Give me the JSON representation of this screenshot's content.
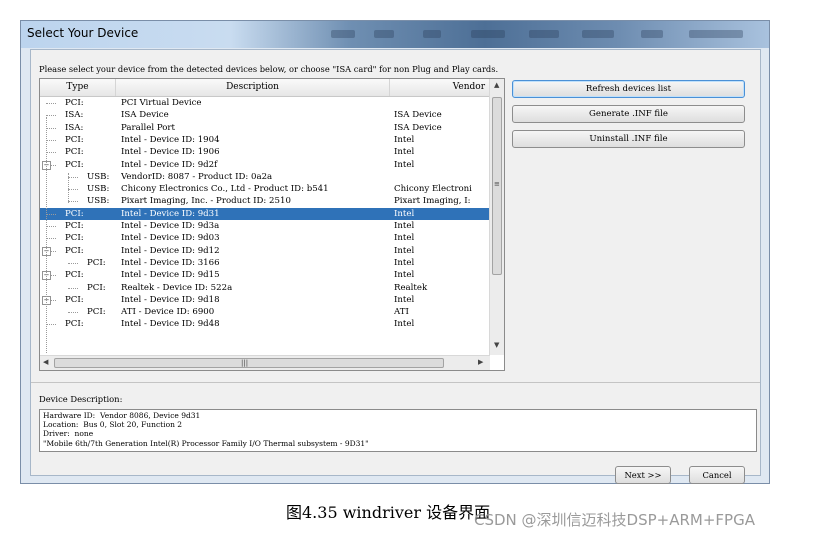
{
  "window": {
    "title": "Select Your Device"
  },
  "prompt": "Please select your device from the detected devices below, or choose \"ISA card\" for non Plug and Play cards.",
  "table": {
    "columns": [
      "Type",
      "Description",
      "Vendor"
    ],
    "rows": [
      {
        "type": "PCI:",
        "desc": "PCI Virtual Device",
        "vendor": ""
      },
      {
        "type": "ISA:",
        "desc": "ISA Device",
        "vendor": "ISA Device"
      },
      {
        "type": "ISA:",
        "desc": "Parallel Port",
        "vendor": "ISA Device"
      },
      {
        "type": "PCI:",
        "desc": "Intel - Device ID: 1904",
        "vendor": "Intel"
      },
      {
        "type": "PCI:",
        "desc": "Intel - Device ID: 1906",
        "vendor": "Intel"
      },
      {
        "type": "PCI:",
        "desc": "Intel - Device ID: 9d2f",
        "vendor": "Intel"
      },
      {
        "type": "USB:",
        "desc": "VendorID: 8087 - Product ID: 0a2a",
        "vendor": ""
      },
      {
        "type": "USB:",
        "desc": "Chicony Electronics Co., Ltd - Product ID: b541",
        "vendor": "Chicony Electroni"
      },
      {
        "type": "USB:",
        "desc": "Pixart Imaging, Inc. - Product ID: 2510",
        "vendor": "Pixart Imaging, I:"
      },
      {
        "type": "PCI:",
        "desc": "Intel - Device ID: 9d31",
        "vendor": "Intel"
      },
      {
        "type": "PCI:",
        "desc": "Intel - Device ID: 9d3a",
        "vendor": "Intel"
      },
      {
        "type": "PCI:",
        "desc": "Intel - Device ID: 9d03",
        "vendor": "Intel"
      },
      {
        "type": "PCI:",
        "desc": "Intel - Device ID: 9d12",
        "vendor": "Intel"
      },
      {
        "type": "PCI:",
        "desc": "Intel - Device ID: 3166",
        "vendor": "Intel"
      },
      {
        "type": "PCI:",
        "desc": "Intel - Device ID: 9d15",
        "vendor": "Intel"
      },
      {
        "type": "PCI:",
        "desc": "Realtek - Device ID: 522a",
        "vendor": "Realtek"
      },
      {
        "type": "PCI:",
        "desc": "Intel - Device ID: 9d18",
        "vendor": "Intel"
      },
      {
        "type": "PCI:",
        "desc": "ATI - Device ID: 6900",
        "vendor": "ATI"
      },
      {
        "type": "PCI:",
        "desc": "Intel - Device ID: 9d48",
        "vendor": "Intel"
      }
    ],
    "selected_row": 9,
    "hscroll_grip": "|||"
  },
  "buttons": {
    "refresh": "Refresh devices list",
    "generate_inf": "Generate .INF file",
    "uninstall_inf": "Uninstall .INF file",
    "next": "Next >>",
    "cancel": "Cancel"
  },
  "description": {
    "label": "Device Description:",
    "text": "Hardware ID:  Vendor 8086, Device 9d31\nLocation:  Bus 0, Slot 20, Function 2\nDriver:  none\n\"Mobile 6th/7th Generation Intel(R) Processor Family I/O Thermal subsystem - 9D31\""
  },
  "caption": "图4.35  windriver 设备界面",
  "watermark": "CSDN @深圳信迈科技DSP+ARM+FPGA",
  "colors": {
    "selection": "#2f72b8",
    "title_accent": "#4d6f96"
  }
}
